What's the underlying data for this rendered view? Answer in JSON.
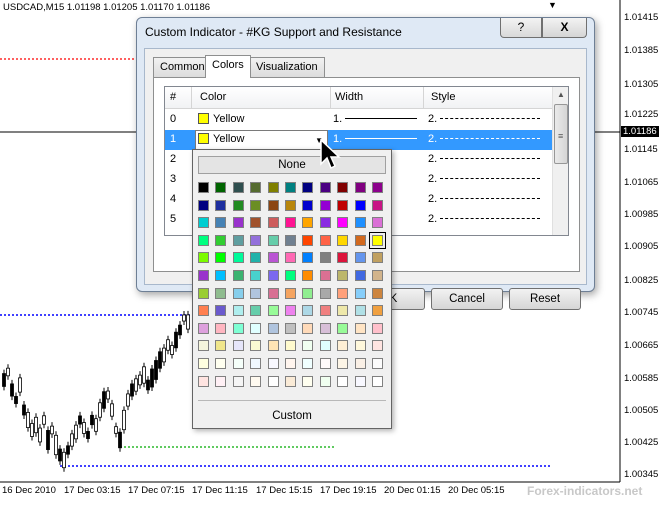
{
  "chart": {
    "symbol": "USDCAD,M15  1.01198 1.01205 1.01170 1.01186",
    "current_price": "1.01186",
    "price_labels": [
      "1.01415",
      "1.01385",
      "1.01305",
      "1.01225",
      "1.01145",
      "1.01065",
      "1.00985",
      "1.00905",
      "1.00825",
      "1.00745",
      "1.00665",
      "1.00585",
      "1.00505",
      "1.00425",
      "1.00345"
    ],
    "time_labels": [
      "16 Dec 2010",
      "17 Dec 03:15",
      "17 Dec 07:15",
      "17 Dec 11:15",
      "17 Dec 15:15",
      "17 Dec 19:15",
      "20 Dec 01:15",
      "20 Dec 05:15"
    ],
    "watermark": "Forex-indicators.net",
    "colors": {
      "resistance": "#ff0000",
      "support": "#0000ff",
      "green_level": "#00aa00",
      "crosshair": "#000000"
    }
  },
  "dialog": {
    "title": "Custom Indicator - #KG Support and Resistance",
    "help_label": "?",
    "close_label": "X",
    "tabs": [
      {
        "label": "Common",
        "active": false
      },
      {
        "label": "Colors",
        "active": true
      },
      {
        "label": "Visualization",
        "active": false
      }
    ],
    "grid": {
      "columns": [
        "#",
        "Color",
        "Width",
        "Style"
      ],
      "rows": [
        {
          "index": "0",
          "color": "Yellow",
          "swatch": "#ffff00",
          "width": "1.",
          "style": "2.",
          "selected": false
        },
        {
          "index": "1",
          "color": "Yellow",
          "swatch": "#ffff00",
          "width": "1.",
          "style": "2.",
          "selected": true
        },
        {
          "index": "2",
          "color": "",
          "width": "1.",
          "style": "2.",
          "selected": false
        },
        {
          "index": "3",
          "color": "",
          "width": "1.",
          "style": "2.",
          "selected": false
        },
        {
          "index": "4",
          "color": "",
          "width": "1.",
          "style": "2.",
          "selected": false
        },
        {
          "index": "5",
          "color": "",
          "width": "1.",
          "style": "2.",
          "selected": false
        }
      ]
    },
    "buttons": {
      "ok": "OK",
      "cancel": "Cancel",
      "reset": "Reset"
    }
  },
  "color_popup": {
    "none_label": "None",
    "custom_label": "Custom",
    "selected_color": "#ffff00",
    "palette": [
      [
        "#000000",
        "#006400",
        "#2f4f4f",
        "#556b2f",
        "#808000",
        "#008080",
        "#000080",
        "#4b0082",
        "#800000",
        "#800080",
        "#8b008b"
      ],
      [
        "#000080",
        "#1e2f9f",
        "#228b22",
        "#6b8e23",
        "#8b4513",
        "#b8860b",
        "#0000cd",
        "#9400d3",
        "#c00000",
        "#0000ff",
        "#c71585"
      ],
      [
        "#00ced1",
        "#4682b4",
        "#9932cc",
        "#a0522d",
        "#cd5c5c",
        "#ff1493",
        "#ffa500",
        "#8a2be2",
        "#ff00ff",
        "#1e90ff",
        "#da70d6"
      ],
      [
        "#00ff7f",
        "#32cd32",
        "#5f9ea0",
        "#9370db",
        "#66cdaa",
        "#708090",
        "#ff4500",
        "#ff6347",
        "#ffd700",
        "#d2691e",
        "#ffff00"
      ],
      [
        "#7cfc00",
        "#00ff00",
        "#00fa9a",
        "#20b2aa",
        "#ba55d3",
        "#ff69b4",
        "#0080ff",
        "#808080",
        "#dc143c",
        "#6495ed",
        "#c0a060"
      ],
      [
        "#9932cc",
        "#00bfff",
        "#3cb371",
        "#48d1cc",
        "#7b68ee",
        "#00ff7f",
        "#ff8c00",
        "#db7093",
        "#bdb76b",
        "#4169e1",
        "#d2b48c"
      ],
      [
        "#9acd32",
        "#8fbc8f",
        "#87ceeb",
        "#b0c4de",
        "#d87093",
        "#f4a460",
        "#90ee90",
        "#a9a9a9",
        "#ffa07a",
        "#87cefa",
        "#cd853f"
      ],
      [
        "#ff7f50",
        "#6a5acd",
        "#afeeee",
        "#66cdaa",
        "#98fb98",
        "#ee82ee",
        "#add8e6",
        "#f08080",
        "#eee8aa",
        "#b0e0e6",
        "#f0a040"
      ],
      [
        "#dda0dd",
        "#ffb6c1",
        "#7fffd4",
        "#e0ffff",
        "#b0c4de",
        "#c0c0c0",
        "#ffdab9",
        "#d8bfd8",
        "#98fb98",
        "#ffe4c4",
        "#ffc0cb"
      ],
      [
        "#f5f5dc",
        "#f0e68c",
        "#e6e6fa",
        "#fafad2",
        "#ffe4b5",
        "#fffacd",
        "#f0fff0",
        "#e0ffff",
        "#ffefd5",
        "#fff8dc",
        "#ffe4e1"
      ],
      [
        "#ffffe0",
        "#fffff0",
        "#f5fffa",
        "#f0f8ff",
        "#f8f8ff",
        "#fff5ee",
        "#f0ffff",
        "#fffafa",
        "#fdf5e6",
        "#faf0e6",
        "#fcfcfc"
      ],
      [
        "#ffe4e1",
        "#fff0f5",
        "#f5f5f5",
        "#fffaf0",
        "#ffffff",
        "#faebd7",
        "#fffff0",
        "#f0fff0",
        "#ffffff",
        "#f8f8ff",
        "#ffffff"
      ]
    ]
  }
}
